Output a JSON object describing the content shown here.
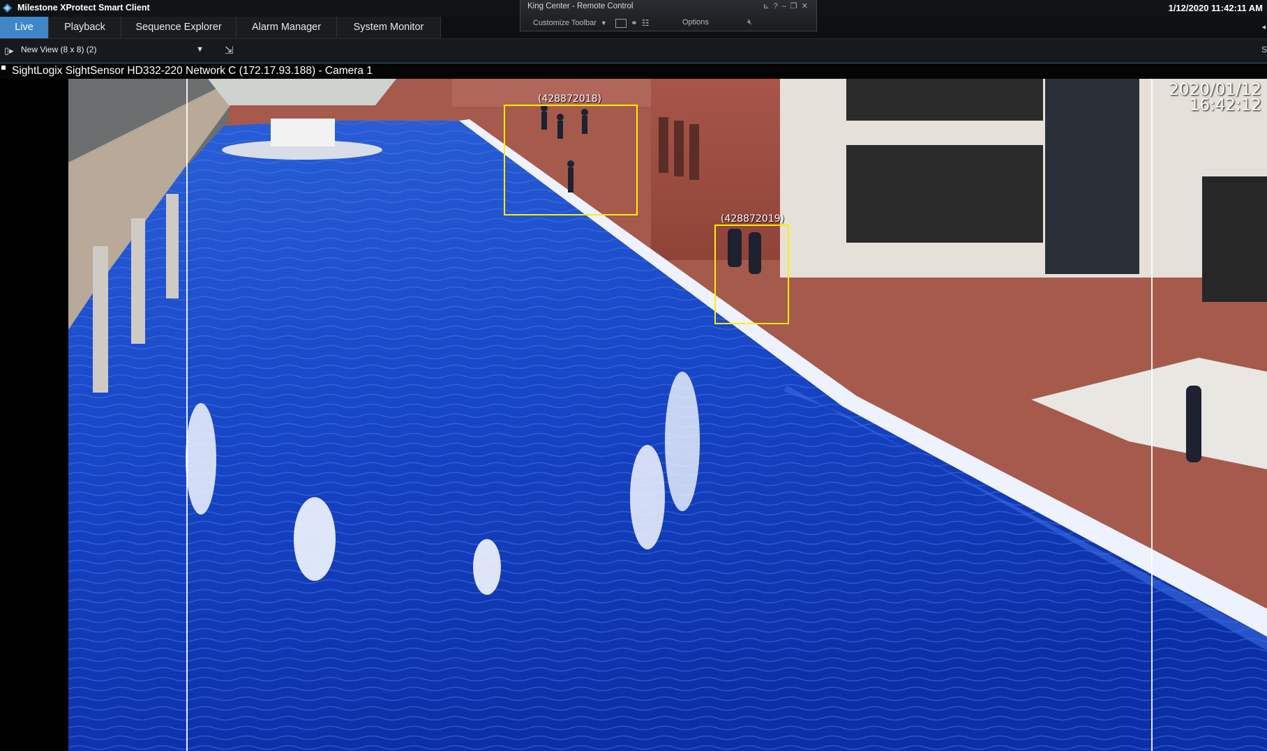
{
  "app": {
    "title": "Milestone XProtect Smart Client",
    "clock": "1/12/2020 11:42:11 AM"
  },
  "remote": {
    "title": "King Center - Remote Control",
    "customize": "Customize Toolbar",
    "options": "Options",
    "controls": {
      "pin": "✕",
      "help": "?",
      "minimize": "–",
      "restore": "❐",
      "close": "✕"
    }
  },
  "tabs": [
    {
      "label": "Live",
      "active": true
    },
    {
      "label": "Playback"
    },
    {
      "label": "Sequence Explorer"
    },
    {
      "label": "Alarm Manager"
    },
    {
      "label": "System Monitor"
    }
  ],
  "toolbar": {
    "view": "New View (8 x 8) (2)",
    "right_label": "S"
  },
  "camera": {
    "title": "SightLogix SightSensor HD332-220 Network C (172.17.93.188) - Camera 1",
    "osd_date": "2020/01/12",
    "osd_time": "16:42:12",
    "objects": [
      {
        "label": "(428872018)"
      },
      {
        "label": "(428872019)"
      }
    ]
  },
  "colors": {
    "accent": "#3f86c8",
    "detection_box": "#ffee00",
    "water": "#1746c7"
  }
}
